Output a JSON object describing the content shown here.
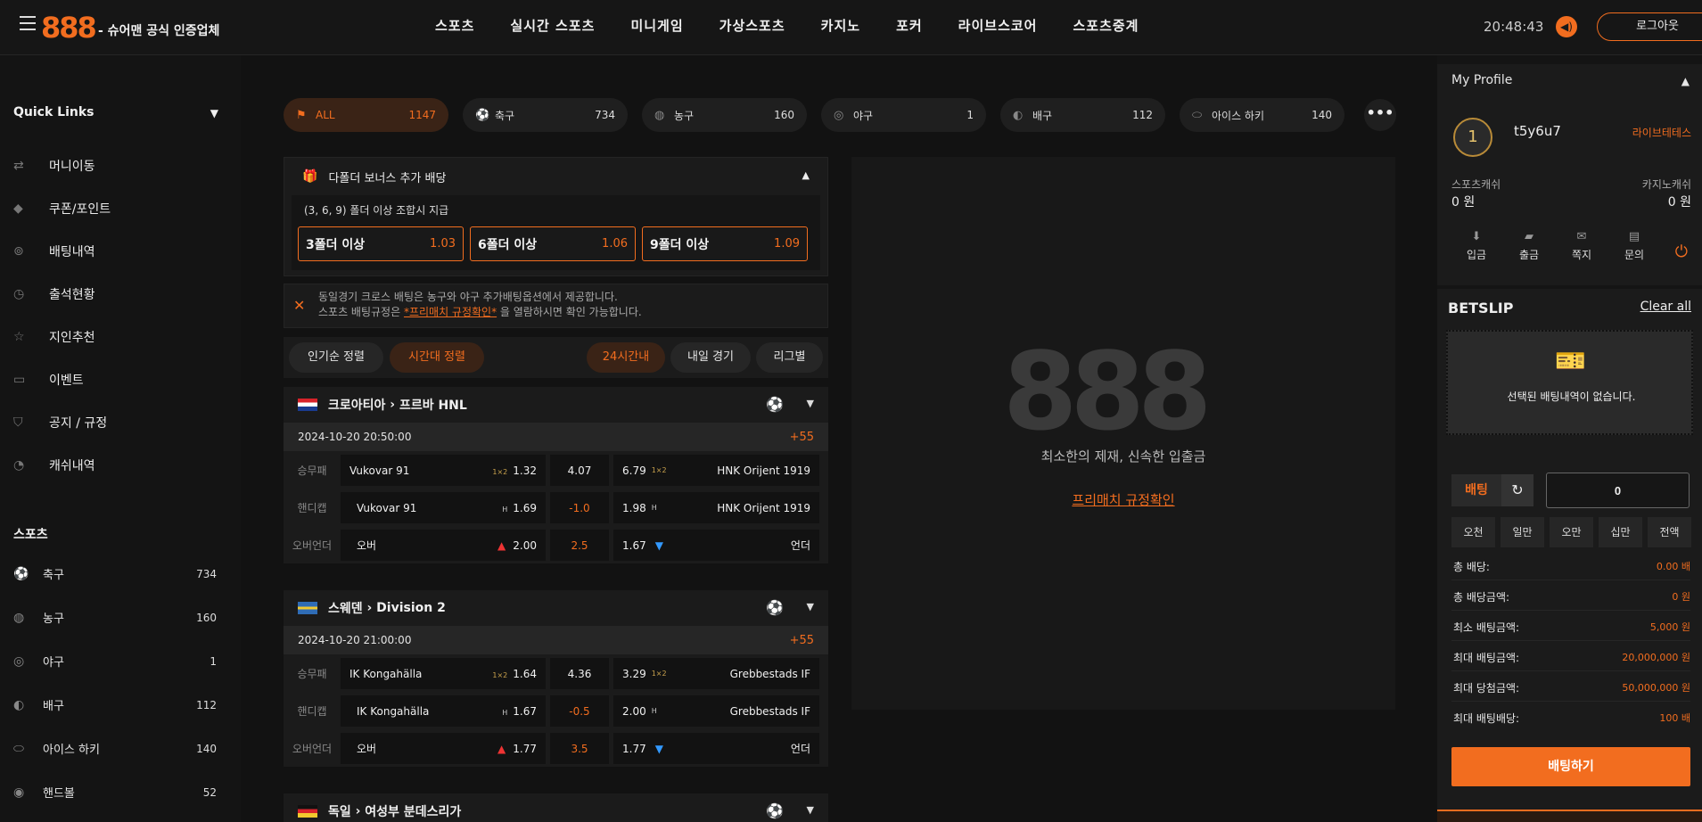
{
  "header": {
    "logo": "888",
    "tagline": "- 슈어맨 공식 인증업체",
    "nav": [
      "스포츠",
      "실시간 스포츠",
      "미니게임",
      "가상스포츠",
      "카지노",
      "포커",
      "라이브스코어",
      "스포츠중계"
    ],
    "clock": "20:48:43",
    "logout_label": "로그아웃"
  },
  "sidebar": {
    "quick_links_title": "Quick Links",
    "quick_links": [
      {
        "label": "머니이동",
        "icon": "money-transfer-icon"
      },
      {
        "label": "쿠폰/포인트",
        "icon": "coupon-icon"
      },
      {
        "label": "배팅내역",
        "icon": "bet-history-icon"
      },
      {
        "label": "출석현황",
        "icon": "clock-icon"
      },
      {
        "label": "지인추천",
        "icon": "star-icon"
      },
      {
        "label": "이벤트",
        "icon": "ticket-icon"
      },
      {
        "label": "공지 / 규정",
        "icon": "shield-icon"
      },
      {
        "label": "캐쉬내역",
        "icon": "cash-history-icon"
      }
    ],
    "sports_title": "스포츠",
    "sports": [
      {
        "label": "축구",
        "count": "734"
      },
      {
        "label": "농구",
        "count": "160"
      },
      {
        "label": "야구",
        "count": "1"
      },
      {
        "label": "배구",
        "count": "112"
      },
      {
        "label": "아이스 하키",
        "count": "140"
      },
      {
        "label": "핸드볼",
        "count": "52"
      }
    ]
  },
  "tabs": [
    {
      "label": "ALL",
      "count": "1147"
    },
    {
      "label": "축구",
      "count": "734"
    },
    {
      "label": "농구",
      "count": "160"
    },
    {
      "label": "야구",
      "count": "1"
    },
    {
      "label": "배구",
      "count": "112"
    },
    {
      "label": "아이스 하키",
      "count": "140"
    }
  ],
  "bonus": {
    "title": "다폴더 보너스 추가 배당",
    "subtitle": "(3, 6, 9) 폴더 이상 조합시 지급",
    "options": [
      {
        "label": "3폴더 이상",
        "odds": "1.03"
      },
      {
        "label": "6폴더 이상",
        "odds": "1.06"
      },
      {
        "label": "9폴더 이상",
        "odds": "1.09"
      }
    ]
  },
  "notice": {
    "line1": "동일경기 크로스 배팅은 농구와 야구 추가배팅옵션에서 제공합니다.",
    "line2_pre": "스포츠 배팅규정은 ",
    "line2_link": "*프리매치 규정확인*",
    "line2_post": " 을 열람하시면 확인 가능합니다."
  },
  "sort": {
    "popular": "인기순 정렬",
    "time": "시간대 정렬",
    "within24": "24시간내",
    "tomorrow": "내일 경기",
    "league": "리그별"
  },
  "leagues": [
    {
      "country": "크로아티아",
      "name": "프르바 HNL",
      "datetime": "2024-10-20 20:50:00",
      "more": "+55",
      "rows": [
        {
          "type": "승무패",
          "home": "Vukovar 91",
          "home_odds": "1.32",
          "mid": "4.07",
          "away_odds": "6.79",
          "away": "HNK Orijent 1919"
        },
        {
          "type": "핸디캡",
          "home": "Vukovar 91",
          "home_odds": "1.69",
          "mid": "-1.0",
          "away_odds": "1.98",
          "away": "HNK Orijent 1919"
        },
        {
          "type": "오버언더",
          "home": "오버",
          "home_odds": "2.00",
          "mid": "2.5",
          "away_odds": "1.67",
          "away": "언더"
        }
      ]
    },
    {
      "country": "스웨덴",
      "name": "Division 2",
      "datetime": "2024-10-20 21:00:00",
      "more": "+55",
      "rows": [
        {
          "type": "승무패",
          "home": "IK Kongahälla",
          "home_odds": "1.64",
          "mid": "4.36",
          "away_odds": "3.29",
          "away": "Grebbestads IF"
        },
        {
          "type": "핸디캡",
          "home": "IK Kongahälla",
          "home_odds": "1.67",
          "mid": "-0.5",
          "away_odds": "2.00",
          "away": "Grebbestads IF"
        },
        {
          "type": "오버언더",
          "home": "오버",
          "home_odds": "1.77",
          "mid": "3.5",
          "away_odds": "1.77",
          "away": "언더"
        }
      ]
    },
    {
      "country": "독일",
      "name": "여성부 분데스리가"
    }
  ],
  "center": {
    "logo": "888",
    "caption": "최소한의 제재, 신속한 입출금",
    "rule_link": "프리매치 규정확인"
  },
  "profile": {
    "title": "My Profile",
    "badge": "1",
    "username": "t5y6u7",
    "level": "라이브테테스",
    "sports_cash_label": "스포츠캐쉬",
    "sports_cash": "0 원",
    "casino_cash_label": "카지노캐쉬",
    "casino_cash": "0 원",
    "actions": [
      "입금",
      "출금",
      "쪽지",
      "문의"
    ]
  },
  "betslip": {
    "title": "BETSLIP",
    "clear": "Clear all",
    "empty": "선택된 배팅내역이 없습니다.",
    "bet_label": "배팅",
    "amount": "0",
    "chips": [
      "오천",
      "일만",
      "오만",
      "십만",
      "전액"
    ],
    "summary": [
      {
        "label": "총 배당:",
        "value": "0.00 배"
      },
      {
        "label": "총 배당금액:",
        "value": "0 원"
      },
      {
        "label": "최소 배팅금액:",
        "value": "5,000 원"
      },
      {
        "label": "최대 배팅금액:",
        "value": "20,000,000 원"
      },
      {
        "label": "최대 당첨금액:",
        "value": "50,000,000 원"
      },
      {
        "label": "최대 배팅배당:",
        "value": "100 배"
      }
    ],
    "place": "배팅하기"
  },
  "colors": {
    "accent": "#f26d1f",
    "background": "#121212",
    "panel": "#1b1b1b"
  }
}
